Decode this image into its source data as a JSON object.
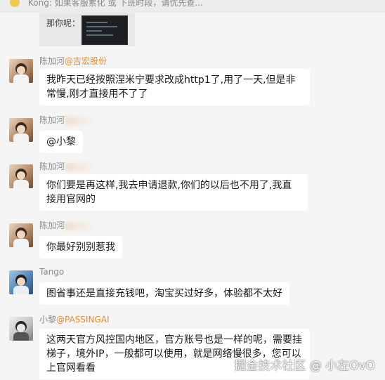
{
  "topbar": {
    "text": "Kong: 如果客服累化 或 下班时段，请优先查..."
  },
  "quoted": {
    "label": "那你呢："
  },
  "messages": [
    {
      "sender": "陈加河",
      "tag": "@吉宏股份",
      "text": "我昨天已经按照涅米宁要求改成http1了,用了一天,但是非常慢,刚才直接用不了了"
    },
    {
      "sender": "陈加河",
      "tag": "",
      "text": "@小黎"
    },
    {
      "sender": "陈加河",
      "tag": "",
      "text": "你们要是再这样,我去申请退款,你们的以后也不用了,我直接用官网的"
    },
    {
      "sender": "陈加河",
      "tag": "",
      "text": "你最好别别惹我"
    },
    {
      "sender": "Tango",
      "tag": "",
      "text": "图省事还是直接充钱吧，淘宝买过好多，体验都不太好"
    },
    {
      "sender": "小黎",
      "tag": "@PASSINGAI",
      "text": "这两天官方风控国内地区，官方账号也是一样的呢，需要挂梯子，境外IP，一般都可以使用，就是网络慢很多，您可以上官网看看"
    }
  ],
  "watermark": "掘金技术社区 @ 小左OvO"
}
